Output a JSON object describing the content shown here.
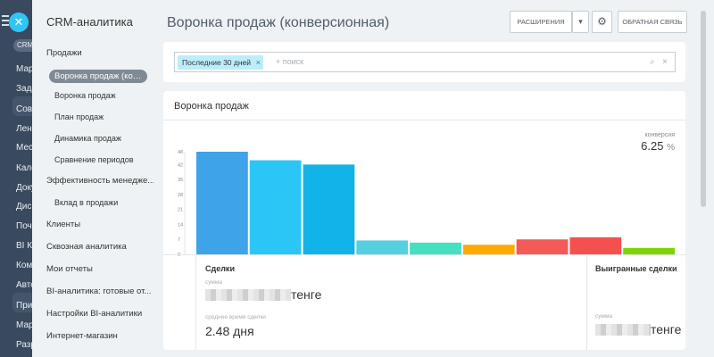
{
  "app_rail": {
    "tag": "CRM",
    "items": [
      "Мар",
      "Зада",
      "Сов",
      "Лен",
      "Мес",
      "Кале",
      "Доку",
      "Дис",
      "Почт",
      "BI Ко",
      "Ком",
      "Авто",
      "При",
      "Мар",
      "Разр"
    ]
  },
  "menu": {
    "title": "CRM-аналитика",
    "items": [
      {
        "label": "Продажи",
        "level": "top"
      },
      {
        "label": "Воронка продаж (кон...",
        "level": "active"
      },
      {
        "label": "Воронка продаж",
        "level": "sub"
      },
      {
        "label": "План продаж",
        "level": "sub"
      },
      {
        "label": "Динамика продаж",
        "level": "sub"
      },
      {
        "label": "Сравнение периодов",
        "level": "sub"
      },
      {
        "label": "Эффективность менедже...",
        "level": "top"
      },
      {
        "label": "Вклад в продажи",
        "level": "sub"
      },
      {
        "label": "Клиенты",
        "level": "top"
      },
      {
        "label": "Сквозная аналитика",
        "level": "top"
      },
      {
        "label": "Мои отчеты",
        "level": "top"
      },
      {
        "label": "BI-аналитика: готовые от...",
        "level": "top"
      },
      {
        "label": "Настройки BI-аналитики",
        "level": "top"
      },
      {
        "label": "Интернет-магазин",
        "level": "top"
      }
    ]
  },
  "header": {
    "title": "Воронка продаж (конверсионная)",
    "extensions_label": "РАСШИРЕНИЯ",
    "feedback_label": "ОБРАТНАЯ СВЯЗЬ",
    "dropdown_glyph": "▾",
    "settings_glyph": "⚙"
  },
  "filter": {
    "tag_label": "Последние 30 дней",
    "tag_remove": "×",
    "search_placeholder": "+ поиск",
    "search_glyph": "⌕",
    "clear_glyph": "×"
  },
  "report": {
    "title": "Воронка продаж",
    "conversion_label": "конверсия",
    "conversion_value": "6.25",
    "conversion_unit": "%"
  },
  "chart_data": {
    "type": "bar",
    "yticks": [
      0,
      7,
      14,
      21,
      28,
      35,
      42,
      48
    ],
    "ylim": [
      0,
      48
    ],
    "values": [
      48,
      44,
      42,
      6.5,
      5.5,
      4.5,
      7,
      8,
      3
    ],
    "colors": [
      "#3ea3e8",
      "#2cc6f6",
      "#12b3e8",
      "#55d0e0",
      "#44e0c0",
      "#ffa900",
      "#f45a57",
      "#f4514e",
      "#7bd500"
    ]
  },
  "stats": {
    "deals": {
      "title": "Сделки",
      "sum_label": "сумма",
      "sum_currency": "тенге",
      "avg_label": "среднее время сделки",
      "avg_value": "2.48 дня"
    },
    "won": {
      "title": "Выигранные сделки",
      "sum_label": "сумма",
      "sum_currency": "тенге"
    }
  }
}
